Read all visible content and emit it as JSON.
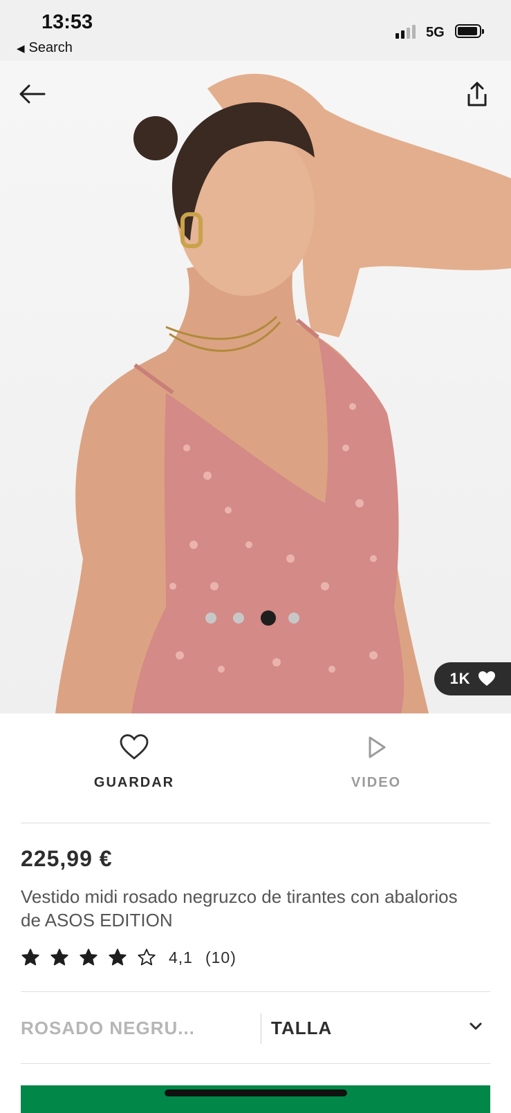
{
  "status_bar": {
    "time": "13:53",
    "back_app_label": "Search",
    "network": "5G",
    "battery_icon": "battery-icon",
    "signal_icon": "signal-icon"
  },
  "hero": {
    "back_icon": "arrow-left-icon",
    "share_icon": "share-icon",
    "likes_count": "1K",
    "likes_icon": "heart-filled-icon"
  },
  "actions": {
    "save_label": "GUARDAR",
    "save_icon": "heart-outline-icon",
    "video_label": "VIDEO",
    "video_icon": "play-icon"
  },
  "product": {
    "price": "225,99 €",
    "title": "Vestido midi rosado negruzco de tirantes con abalorios de ASOS EDITION",
    "rating_value": "4,1",
    "rating_count": "(10)",
    "rating_stars": 4.1,
    "rating_max": 5
  },
  "selectors": {
    "colour_value": "ROSADO NEGRU...",
    "size_label": "TALLA",
    "size_icon": "chevron-down-icon"
  },
  "colors": {
    "brand_green": "#018849",
    "text_dark": "#2d2d2d",
    "text_muted": "#9b9b9b",
    "dress_pink": "#d48a86"
  }
}
